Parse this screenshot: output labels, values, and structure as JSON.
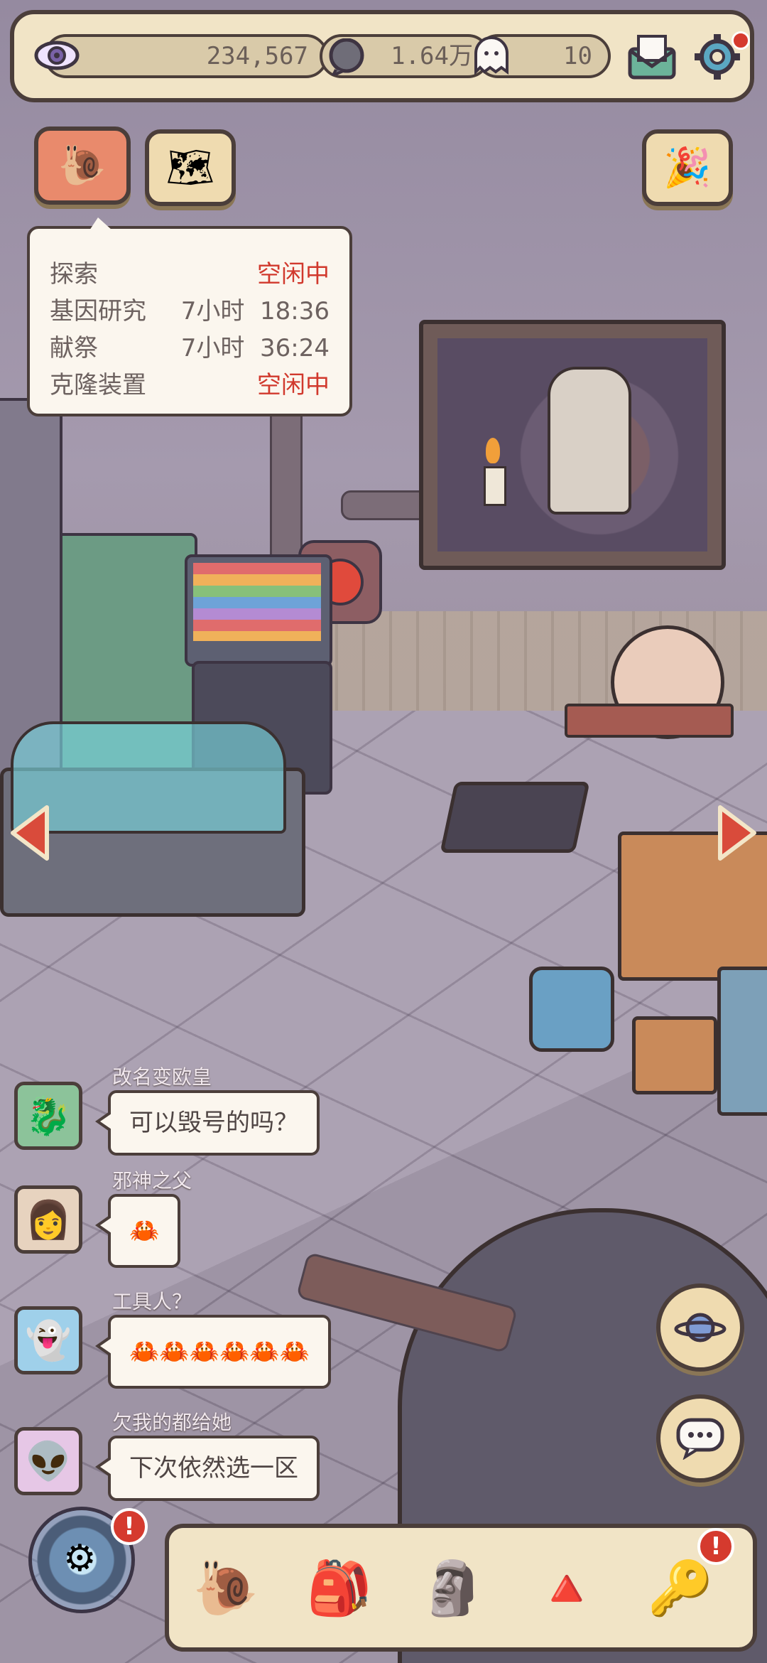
{
  "topbar": {
    "eye_value": "234,567",
    "coin_value": "1.64万",
    "ghost_value": "10",
    "icons": [
      "eye-icon",
      "brain-coin-icon",
      "ghost-icon",
      "mail-icon",
      "gear-icon"
    ]
  },
  "status_popup": {
    "rows": [
      {
        "label": "探索",
        "value": "空闲中",
        "idle": true
      },
      {
        "label": "基因研究",
        "value": "7小时  18:36",
        "idle": false
      },
      {
        "label": "献祭",
        "value": "7小时  36:24",
        "idle": false
      },
      {
        "label": "克隆装置",
        "value": "空闲中",
        "idle": true
      }
    ]
  },
  "chat": [
    {
      "name": "改名变欧皇",
      "message": "可以毁号的吗？",
      "avatar": "dragon-avatar"
    },
    {
      "name": "邪神之父",
      "message": "🦀",
      "avatar": "woman-avatar"
    },
    {
      "name": "工具人？",
      "message": "🦀🦀🦀🦀🦀🦀",
      "avatar": "ghost-avatar"
    },
    {
      "name": "欠我的都给她",
      "message": "下次依然选一区",
      "avatar": "alien-avatar"
    }
  ],
  "bottom_nav": [
    {
      "icon": "snail-icon",
      "glyph": "🐌"
    },
    {
      "icon": "backpack-icon",
      "glyph": "🎒"
    },
    {
      "icon": "statue-icon",
      "glyph": "🗿"
    },
    {
      "icon": "pyramid-icon",
      "glyph": "🔺"
    },
    {
      "icon": "key-icon",
      "glyph": "🔑"
    }
  ],
  "badge_text": "!",
  "colors": {
    "idle_red": "#d1392d",
    "panel_cream": "#f1e4c6",
    "outline": "#4b3e3a"
  }
}
